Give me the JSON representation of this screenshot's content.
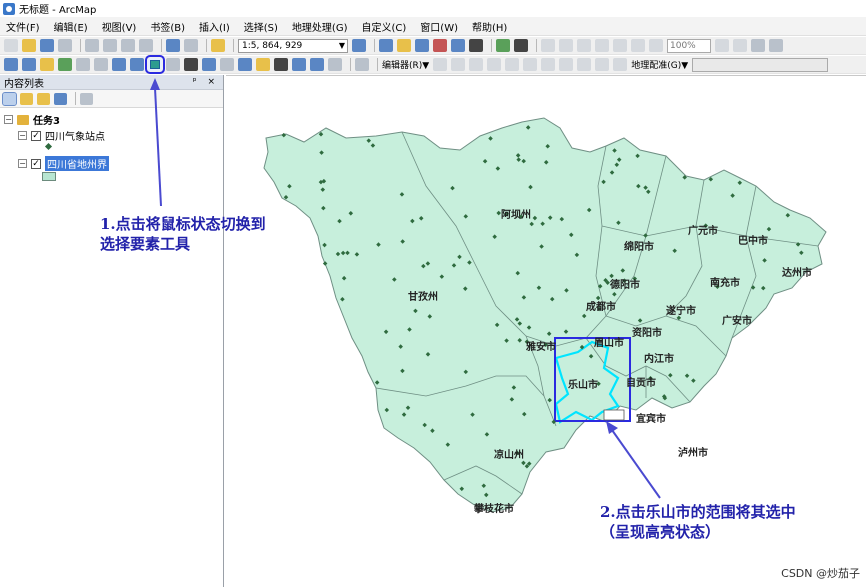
{
  "window": {
    "title": "无标题 - ArcMap"
  },
  "menu": [
    "文件(F)",
    "编辑(E)",
    "视图(V)",
    "书签(B)",
    "插入(I)",
    "选择(S)",
    "地理处理(G)",
    "自定义(C)",
    "窗口(W)",
    "帮助(H)"
  ],
  "toolbar": {
    "scale_value": "1:5, 864, 929",
    "zoom_value": "100%",
    "editor_label": "编辑器(R)▼",
    "georef_label": "地理配准(G)▼"
  },
  "toc": {
    "title": "内容列表",
    "controls": "ᵖ ×",
    "group_name": "任务3",
    "layers": [
      {
        "name": "四川气象站点"
      },
      {
        "name": "四川省地州界"
      }
    ]
  },
  "map": {
    "fill_color": "#c7efdc",
    "selection_color": "#00e5ff",
    "cities": [
      "阿坝州",
      "广元市",
      "巴中市",
      "绵阳市",
      "达州市",
      "德阳市",
      "南充市",
      "甘孜州",
      "成都市",
      "遂宁市",
      "广安市",
      "雅安市",
      "眉山市",
      "资阳市",
      "内江市",
      "乐山市",
      "自贡市",
      "宜宾市",
      "凉山州",
      "泸州市",
      "攀枝花市"
    ]
  },
  "annotations": {
    "step1_line1": "1.点击将鼠标状态切换到",
    "step1_line2": "选择要素工具",
    "step2_line1": "2.点击乐山市的范围将其选中",
    "step2_line2": "（呈现高亮状态）",
    "arrow_color": "#4a4ad0"
  },
  "watermark": "CSDN @炒茄子"
}
